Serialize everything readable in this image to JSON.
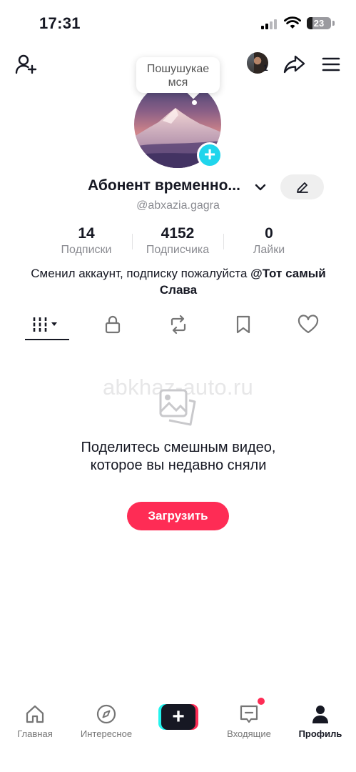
{
  "status_bar": {
    "time": "17:31",
    "battery": "23",
    "battery_level": 0.23
  },
  "header": {
    "tooltip": "Пошушукае мся",
    "following_count_badge": "1",
    "icons": [
      "add-user-icon",
      "share-icon",
      "menu-icon"
    ]
  },
  "profile": {
    "name": "Абонент временно...",
    "handle": "@abxazia.gagra",
    "stats": [
      {
        "value": "14",
        "label": "Подписки"
      },
      {
        "value": "4152",
        "label": "Подписчика"
      },
      {
        "value": "0",
        "label": "Лайки"
      }
    ],
    "bio_text": "Сменил аккаунт, подписку пожалуйста ",
    "bio_mention": "@Тот самый Слава"
  },
  "tabs": [
    {
      "icon": "grid-icon",
      "active": true
    },
    {
      "icon": "lock-icon",
      "active": false
    },
    {
      "icon": "repost-icon",
      "active": false
    },
    {
      "icon": "bookmark-icon",
      "active": false
    },
    {
      "icon": "heart-icon",
      "active": false
    }
  ],
  "empty_state": {
    "watermark": "abkhaz-auto.ru",
    "title": "Поделитесь смешным видео, которое вы недавно сняли",
    "button": "Загрузить"
  },
  "bottom_nav": [
    {
      "label": "Главная",
      "icon": "home-icon"
    },
    {
      "label": "Интересное",
      "icon": "compass-icon"
    },
    {
      "label": "",
      "icon": "create-icon"
    },
    {
      "label": "Входящие",
      "icon": "inbox-icon"
    },
    {
      "label": "Профиль",
      "icon": "profile-icon"
    }
  ],
  "colors": {
    "accent": "#fe2c55",
    "cyan": "#20d5ec",
    "text": "#161823",
    "muted": "#8a8b91"
  }
}
